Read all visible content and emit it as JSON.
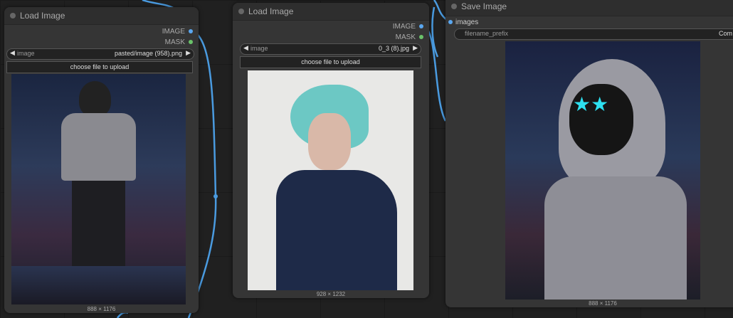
{
  "nodes": [
    {
      "title": "Load Image",
      "outputs": [
        "IMAGE",
        "MASK"
      ],
      "widget_label": "image",
      "widget_value": "pasted/image (958).png",
      "upload_label": "choose file to upload",
      "size": "888 × 1176"
    },
    {
      "title": "Load Image",
      "outputs": [
        "IMAGE",
        "MASK"
      ],
      "widget_label": "image",
      "widget_value": "0_3 (8).jpg",
      "upload_label": "choose file to upload",
      "size": "928 × 1232"
    },
    {
      "title": "Save Image",
      "input": "images",
      "widget_label": "filename_prefix",
      "widget_value": "Com",
      "size": "888 × 1176"
    }
  ],
  "colors": {
    "image_port": "#5aa7f0",
    "mask_port": "#6ac26a",
    "wire": "#4a9be0"
  }
}
